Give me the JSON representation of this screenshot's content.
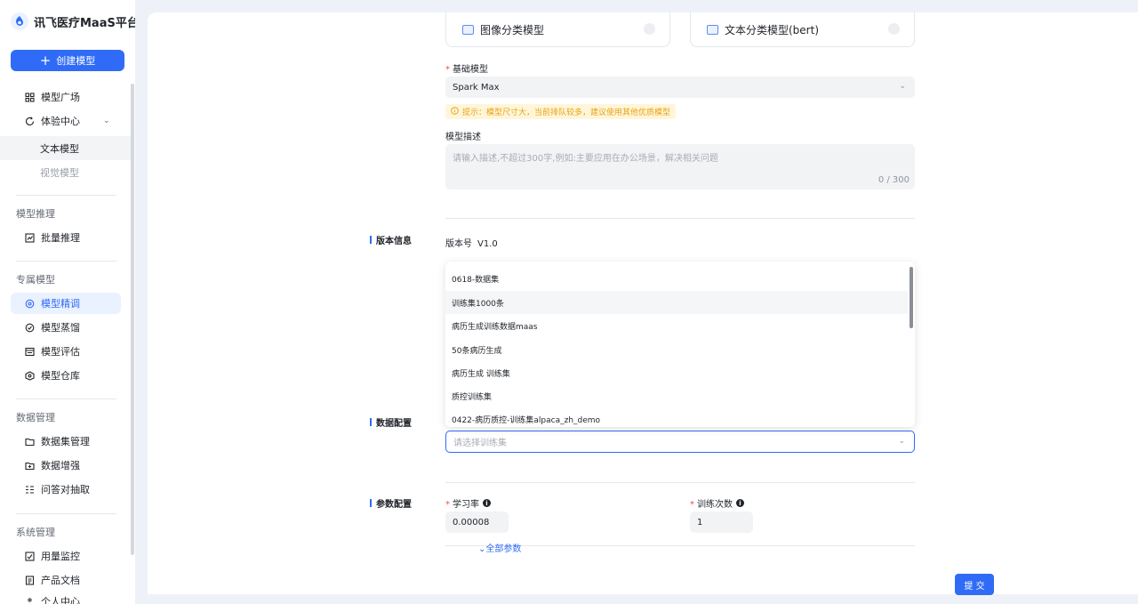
{
  "brand": {
    "title": "讯飞医疗MaaS平台"
  },
  "sidebar": {
    "create_label": "创建模型",
    "items": {
      "plaza": "模型广场",
      "experience": "体验中心",
      "text_model": "文本模型",
      "vision_model": "视觉模型",
      "batch": "批量推理",
      "finetune": "模型精调",
      "distill": "模型蒸馏",
      "eval": "模型评估",
      "warehouse": "模型仓库",
      "dataset_mgmt": "数据集管理",
      "augment": "数据增强",
      "qa_extract": "问答对抽取",
      "usage": "用量监控",
      "docs": "产品文档",
      "profile": "个人中心"
    },
    "groups": {
      "inference": "模型推理",
      "exclusive": "专属模型",
      "data": "数据管理",
      "system": "系统管理"
    }
  },
  "model_types": [
    {
      "label": "图像分类模型"
    },
    {
      "label": "文本分类模型(bert)"
    }
  ],
  "form": {
    "base_model_label": "基础模型",
    "base_model_value": "Spark Max",
    "hint": "提示：模型尺寸大，当前排队较多，建议使用其他优质模型",
    "desc_label": "模型描述",
    "desc_placeholder": "请输入描述,不超过300字,例如:主要应用在办公场景，解决相关问题",
    "desc_counter": "0 / 300",
    "version_section": "版本信息",
    "version_label": "版本号",
    "version_value": "V1.0",
    "data_section": "数据配置",
    "dataset_placeholder": "请选择训练集",
    "dataset_options": [
      "0618-数据集",
      "训练集1000条",
      "病历生成训练数据maas",
      "50条病历生成",
      "病历生成 训练集",
      "质控训练集",
      "0422-病历质控-训练集alpaca_zh_demo"
    ],
    "param_section": "参数配置",
    "lr_label": "学习率",
    "lr_value": "0.00008",
    "epochs_label": "训练次数",
    "epochs_value": "1",
    "expand_label": "全部参数",
    "submit_label": "提 交"
  },
  "colors": {
    "accent": "#2f6bf6",
    "warning": "#e8a317",
    "required": "#f54a45"
  }
}
